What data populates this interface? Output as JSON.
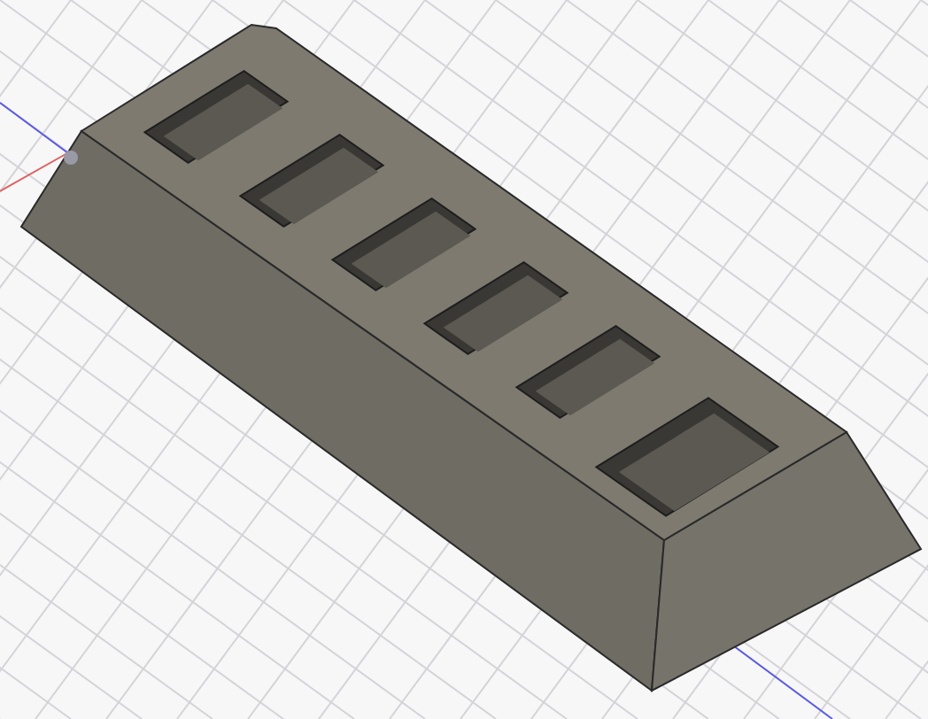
{
  "axes": [
    {
      "color": "#e06060"
    },
    {
      "color": "#5a5ae6"
    }
  ]
}
